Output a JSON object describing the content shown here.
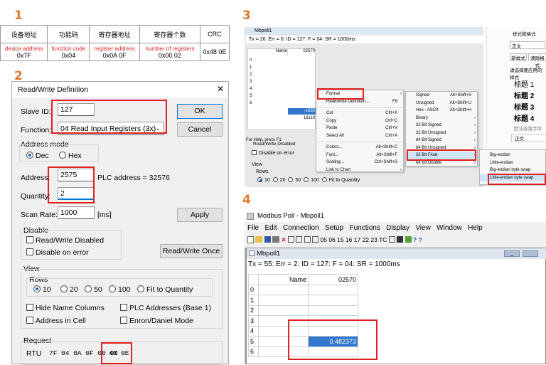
{
  "steps": {
    "s1": "1",
    "s2": "2",
    "s3": "3",
    "s4": "4"
  },
  "panel1": {
    "headers": [
      "设备地址",
      "功能码",
      "寄存器地址",
      "寄存器个数",
      "CRC"
    ],
    "labels": [
      "device address",
      "function code",
      "register address",
      "number of registers",
      ""
    ],
    "values": [
      "0x7F",
      "0x04",
      "0x0A 0F",
      "0x00 02",
      "0x48 0E"
    ]
  },
  "dialog": {
    "title": "Read/Write Definition",
    "close": "✕",
    "slave_label": "Slave ID:",
    "slave_value": "127",
    "ok": "OK",
    "function_label": "Function:",
    "function_value": "04 Read Input Registers (3x)",
    "cancel": "Cancel",
    "address_mode": "Address mode",
    "dec": "Dec",
    "hex": "Hex",
    "address_label": "Address:",
    "address_value": "2575",
    "plc_address": "PLC address = 32576",
    "quantity_label": "Quantity:",
    "quantity_value": "2",
    "scan_label": "Scan Rate:",
    "scan_value": "1000",
    "scan_unit": "[ms]",
    "apply": "Apply",
    "disable": "Disable",
    "rw_disabled": "Read/Write Disabled",
    "disable_error": "Disable on error",
    "rw_once": "Read/Write Once",
    "view": "View",
    "rows": "Rows",
    "rows_opts": [
      "10",
      "20",
      "50",
      "100",
      "Fit to Quantity"
    ],
    "hide_names": "Hide Name Columns",
    "plc_addresses": "PLC Addresses (Base 1)",
    "addr_in_cell": "Address in Cell",
    "enron": "Enron/Daniel Mode",
    "request": "Request",
    "rtu": "RTU",
    "rtu_bytes": "7F 04 0A 0F 00 02",
    "rtu_crc": "48 0E"
  },
  "panel3": {
    "win_title": "Mbpoll1",
    "status": "Tx = 26: Err = 0: ID = 127: F = 04: SR = 1000ms",
    "col_name": "Name",
    "col_addr": "02570",
    "rows": [
      "0",
      "1",
      "2",
      "3",
      "4",
      "5",
      "6"
    ],
    "cell5": "-1635",
    "cell6": "16118",
    "help": "For Help, press F1",
    "rw_disabled": "Read/Write Disabled",
    "disable_error": "Disable on error",
    "view": "View",
    "rows_label": "Rows",
    "rows_opts": [
      "10",
      "20",
      "50",
      "100",
      "Fit to Quantity"
    ],
    "menu1": [
      {
        "label": "Format",
        "sc": "",
        "ar": "›"
      },
      {
        "label": "Read/write Definition...",
        "sc": "F8",
        "ar": ""
      },
      {
        "label": "Cut",
        "sc": "Ctrl+X",
        "ar": ""
      },
      {
        "label": "Copy",
        "sc": "Ctrl+C",
        "ar": ""
      },
      {
        "label": "Paste",
        "sc": "Ctrl+V",
        "ar": ""
      },
      {
        "label": "Select All",
        "sc": "Ctrl+A",
        "ar": ""
      },
      {
        "label": "Colors...",
        "sc": "Alt+Shift+C",
        "ar": ""
      },
      {
        "label": "Font...",
        "sc": "Alt+Shift+F",
        "ar": ""
      },
      {
        "label": "Scaling...",
        "sc": "Ctrl+Shift+S",
        "ar": ""
      },
      {
        "label": "Link to Chart",
        "sc": "",
        "ar": "›"
      }
    ],
    "menu2": [
      {
        "label": "Signed",
        "sc": "Alt+Shift+S",
        "ar": ""
      },
      {
        "label": "Unsigned",
        "sc": "Alt+Shift+U",
        "ar": ""
      },
      {
        "label": "Hex - ASCII",
        "sc": "Alt+Shift+H",
        "ar": ""
      },
      {
        "label": "Binary",
        "sc": "",
        "ar": "›"
      },
      {
        "label": "32 Bit Signed",
        "sc": "",
        "ar": "›"
      },
      {
        "label": "32 Bit Unsigned",
        "sc": "",
        "ar": "›"
      },
      {
        "label": "64 Bit Signed",
        "sc": "",
        "ar": "›"
      },
      {
        "label": "64 Bit Unsigned",
        "sc": "",
        "ar": "›"
      },
      {
        "label": "32 Bit Float",
        "sc": "",
        "ar": "›"
      },
      {
        "label": "64 Bit Double",
        "sc": "",
        "ar": "›"
      }
    ],
    "menu3": [
      "Big-endian",
      "Little-endian",
      "Big-endian byte swap",
      "Little-endian byte swap"
    ],
    "side_title": "样式和格式",
    "side_field": "正文",
    "side_new": "新样式",
    "side_clear": "清除格式",
    "side_hint": "请选择要应用的样式",
    "side_items": [
      "标题 1",
      "标题 2",
      "标题 3",
      "标题 4",
      "默认段落字体",
      "正文"
    ]
  },
  "panel4": {
    "title": "Modbus Poll - Mbpoll1",
    "menu": [
      "File",
      "Edit",
      "Connection",
      "Setup",
      "Functions",
      "Display",
      "View",
      "Window",
      "Help"
    ],
    "toolbar_codes": "05 06 15 16 17 22 23",
    "toolbar_tc": "TC",
    "child_title": "Mbpoll1",
    "status": "Tx = 55: Err = 2: ID = 127: F = 04: SR = 1000ms",
    "col_name": "Name",
    "col_addr": "02570",
    "rows": [
      "0",
      "1",
      "2",
      "3",
      "4",
      "5",
      "6"
    ],
    "cell5": "0.482373"
  },
  "colors": {
    "accent_red": "#e02020",
    "step_orange": "#e07a2e",
    "select_blue": "#3377cc"
  }
}
